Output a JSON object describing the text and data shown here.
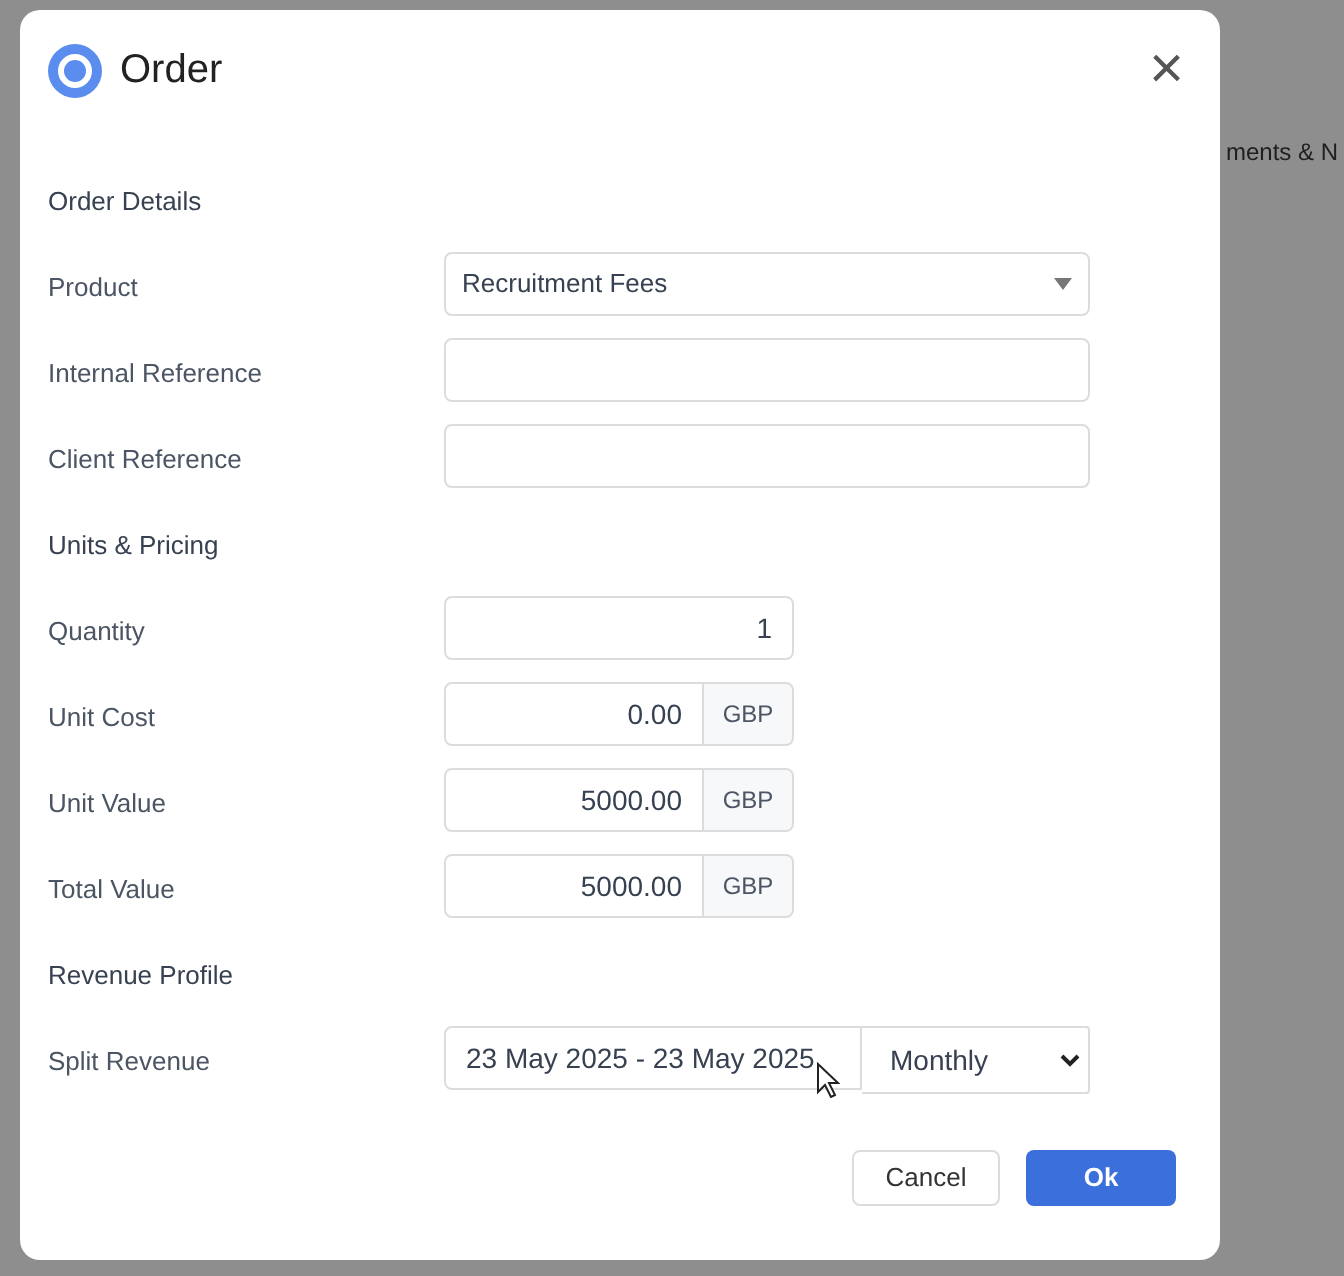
{
  "background": {
    "fragments": [
      "ments & N"
    ]
  },
  "dialog": {
    "title": "Order",
    "close": "×",
    "sections": [
      {
        "heading": "Order Details",
        "fields": [
          {
            "label": "Product",
            "kind": "select",
            "value": "Recruitment Fees"
          },
          {
            "label": "Internal Reference",
            "kind": "text"
          },
          {
            "label": "Client Reference",
            "kind": "text"
          }
        ]
      },
      {
        "heading": "Units & Pricing",
        "fields": [
          {
            "label": "Quantity",
            "kind": "number",
            "value": "1"
          },
          {
            "label": "Unit Cost",
            "kind": "currency",
            "value": "0.00",
            "suffix": "GBP"
          },
          {
            "label": "Unit Value",
            "kind": "currency",
            "value": "5000.00",
            "suffix": "GBP"
          },
          {
            "label": "Total Value",
            "kind": "currency",
            "value": "5000.00",
            "suffix": "GBP"
          }
        ]
      },
      {
        "heading": "Revenue Profile",
        "fields": [
          {
            "label": "Split Revenue",
            "kind": "daterange",
            "value": "23 May 2025 - 23 May 2025",
            "period": "Monthly"
          }
        ]
      }
    ],
    "buttons": [
      {
        "label": "Cancel",
        "kind": "secondary"
      },
      {
        "label": "Ok",
        "kind": "primary"
      }
    ]
  }
}
